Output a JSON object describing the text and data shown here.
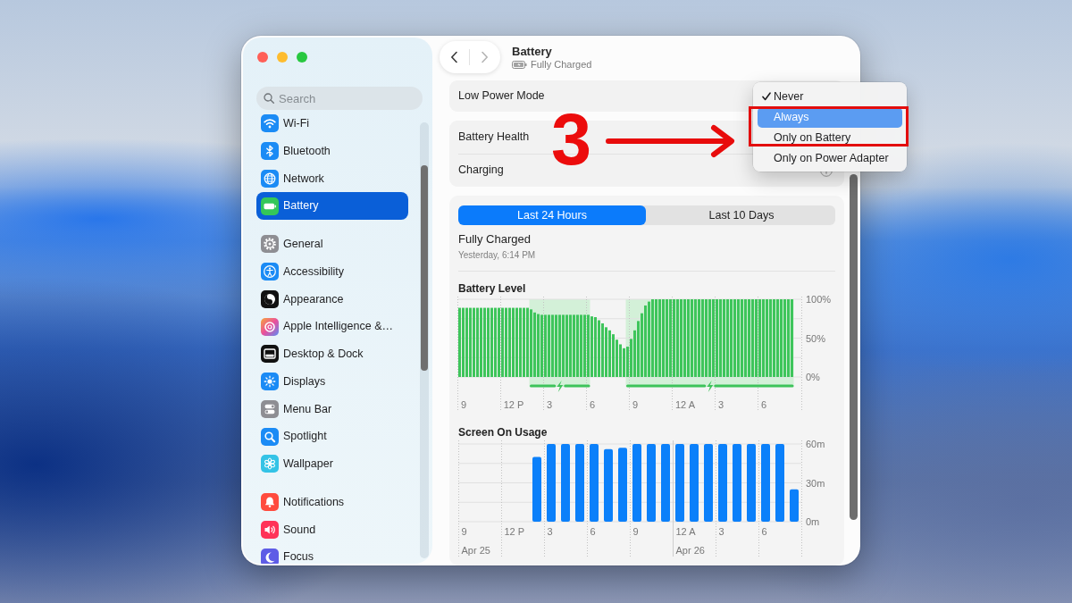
{
  "window": {
    "title": "Battery",
    "subtitle": "Fully Charged"
  },
  "navigation": {
    "back_disabled": false,
    "forward_disabled": true
  },
  "sidebar": {
    "search": {
      "placeholder": "Search"
    },
    "groups": [
      {
        "items": [
          {
            "label": "Wi-Fi",
            "selected": false
          },
          {
            "label": "Bluetooth",
            "selected": false
          },
          {
            "label": "Network",
            "selected": false
          },
          {
            "label": "Battery",
            "selected": true
          }
        ]
      },
      {
        "items": [
          {
            "label": "General",
            "selected": false
          },
          {
            "label": "Accessibility",
            "selected": false
          },
          {
            "label": "Appearance",
            "selected": false
          },
          {
            "label": "Apple Intelligence &…",
            "selected": false
          },
          {
            "label": "Desktop & Dock",
            "selected": false
          },
          {
            "label": "Displays",
            "selected": false
          },
          {
            "label": "Menu Bar",
            "selected": false
          },
          {
            "label": "Spotlight",
            "selected": false
          },
          {
            "label": "Wallpaper",
            "selected": false
          }
        ]
      },
      {
        "items": [
          {
            "label": "Notifications",
            "selected": false
          },
          {
            "label": "Sound",
            "selected": false
          },
          {
            "label": "Focus",
            "selected": false
          }
        ]
      }
    ]
  },
  "settings_groups": [
    {
      "rows": [
        {
          "label": "Low Power Mode",
          "info": false
        }
      ]
    },
    {
      "rows": [
        {
          "label": "Battery Health",
          "info": false
        },
        {
          "label": "Charging",
          "info": true
        }
      ]
    }
  ],
  "low_power_menu": {
    "items": [
      {
        "label": "Never",
        "checked": true,
        "selected": false,
        "boxed": false
      },
      {
        "label": "Always",
        "checked": false,
        "selected": true,
        "boxed": true
      },
      {
        "label": "Only on Battery",
        "checked": false,
        "selected": false,
        "boxed": true
      },
      {
        "label": "Only on Power Adapter",
        "checked": false,
        "selected": false,
        "boxed": false
      }
    ]
  },
  "usage": {
    "tabs": [
      {
        "label": "Last 24 Hours",
        "selected": true
      },
      {
        "label": "Last 10 Days",
        "selected": false
      }
    ],
    "last_charge": {
      "title": "Fully Charged",
      "time": "Yesterday, 6:14 PM"
    },
    "battery_chart": {
      "chart_data": {
        "type": "bar",
        "title": "Battery Level",
        "categories": [
          null,
          "9",
          null,
          null,
          null,
          null,
          null,
          null,
          null,
          null,
          null,
          null,
          null,
          null,
          null,
          "12 P",
          null,
          null,
          null,
          null,
          null,
          null,
          null,
          null,
          null,
          "3",
          null,
          null,
          null,
          null,
          null,
          null,
          null,
          null,
          null,
          null,
          null,
          "6",
          null,
          null,
          null,
          null,
          null,
          null,
          null,
          null,
          null,
          null,
          null,
          "9",
          null,
          null,
          null,
          null,
          null,
          null,
          null,
          null,
          null,
          null,
          null,
          null,
          null,
          "12 A",
          null,
          null,
          null,
          null,
          null,
          null,
          null,
          null,
          null,
          "3",
          null,
          null,
          null,
          null,
          null,
          null,
          null,
          null,
          null,
          null,
          null,
          "6",
          null,
          null,
          null,
          null,
          null,
          null,
          null,
          null,
          null,
          null
        ],
        "values": [
          89,
          89,
          89,
          89,
          89,
          89,
          89,
          89,
          89,
          89,
          89,
          89,
          89,
          89,
          89,
          89,
          89,
          89,
          89,
          89,
          87,
          83,
          81,
          80,
          80,
          80,
          80,
          80,
          80,
          80,
          80,
          80,
          80,
          80,
          80,
          80,
          80,
          78,
          77,
          73,
          69,
          64,
          60,
          55,
          48,
          42,
          37,
          39,
          49,
          60,
          72,
          82,
          92,
          97,
          100,
          100,
          100,
          100,
          100,
          100,
          100,
          100,
          100,
          100,
          100,
          100,
          100,
          100,
          100,
          100,
          100,
          100,
          100,
          100,
          100,
          100,
          100,
          100,
          100,
          100,
          100,
          100,
          100,
          100,
          100,
          100,
          100,
          100,
          100,
          100,
          100,
          100,
          100,
          100,
          null,
          null
        ],
        "ylim": [
          0,
          100
        ],
        "yticks": [
          {
            "value": 0,
            "label": "0%"
          },
          {
            "value": 50,
            "label": "50%"
          },
          {
            "value": 100,
            "label": "100%"
          }
        ]
      }
    },
    "screen_chart": {
      "chart_data": {
        "type": "bar",
        "title": "Screen On Usage",
        "categories": [
          "9",
          null,
          null,
          "12 P",
          null,
          null,
          "3",
          null,
          null,
          "6",
          null,
          null,
          "9",
          null,
          null,
          "12 A",
          null,
          null,
          "3",
          null,
          null,
          "6",
          null,
          null
        ],
        "values": [
          0,
          0,
          0,
          0,
          0,
          50,
          60,
          60,
          60,
          60,
          56,
          57,
          60,
          60,
          60,
          60,
          60,
          60,
          60,
          60,
          60,
          60,
          60,
          25
        ],
        "ylim": [
          0,
          60
        ],
        "yticks": [
          {
            "value": 0,
            "label": "0m"
          },
          {
            "value": 30,
            "label": "30m"
          },
          {
            "value": 60,
            "label": "60m"
          }
        ],
        "annotations": [
          "Apr 25",
          "Apr 26"
        ]
      }
    }
  },
  "annotation": {
    "step": "3"
  }
}
